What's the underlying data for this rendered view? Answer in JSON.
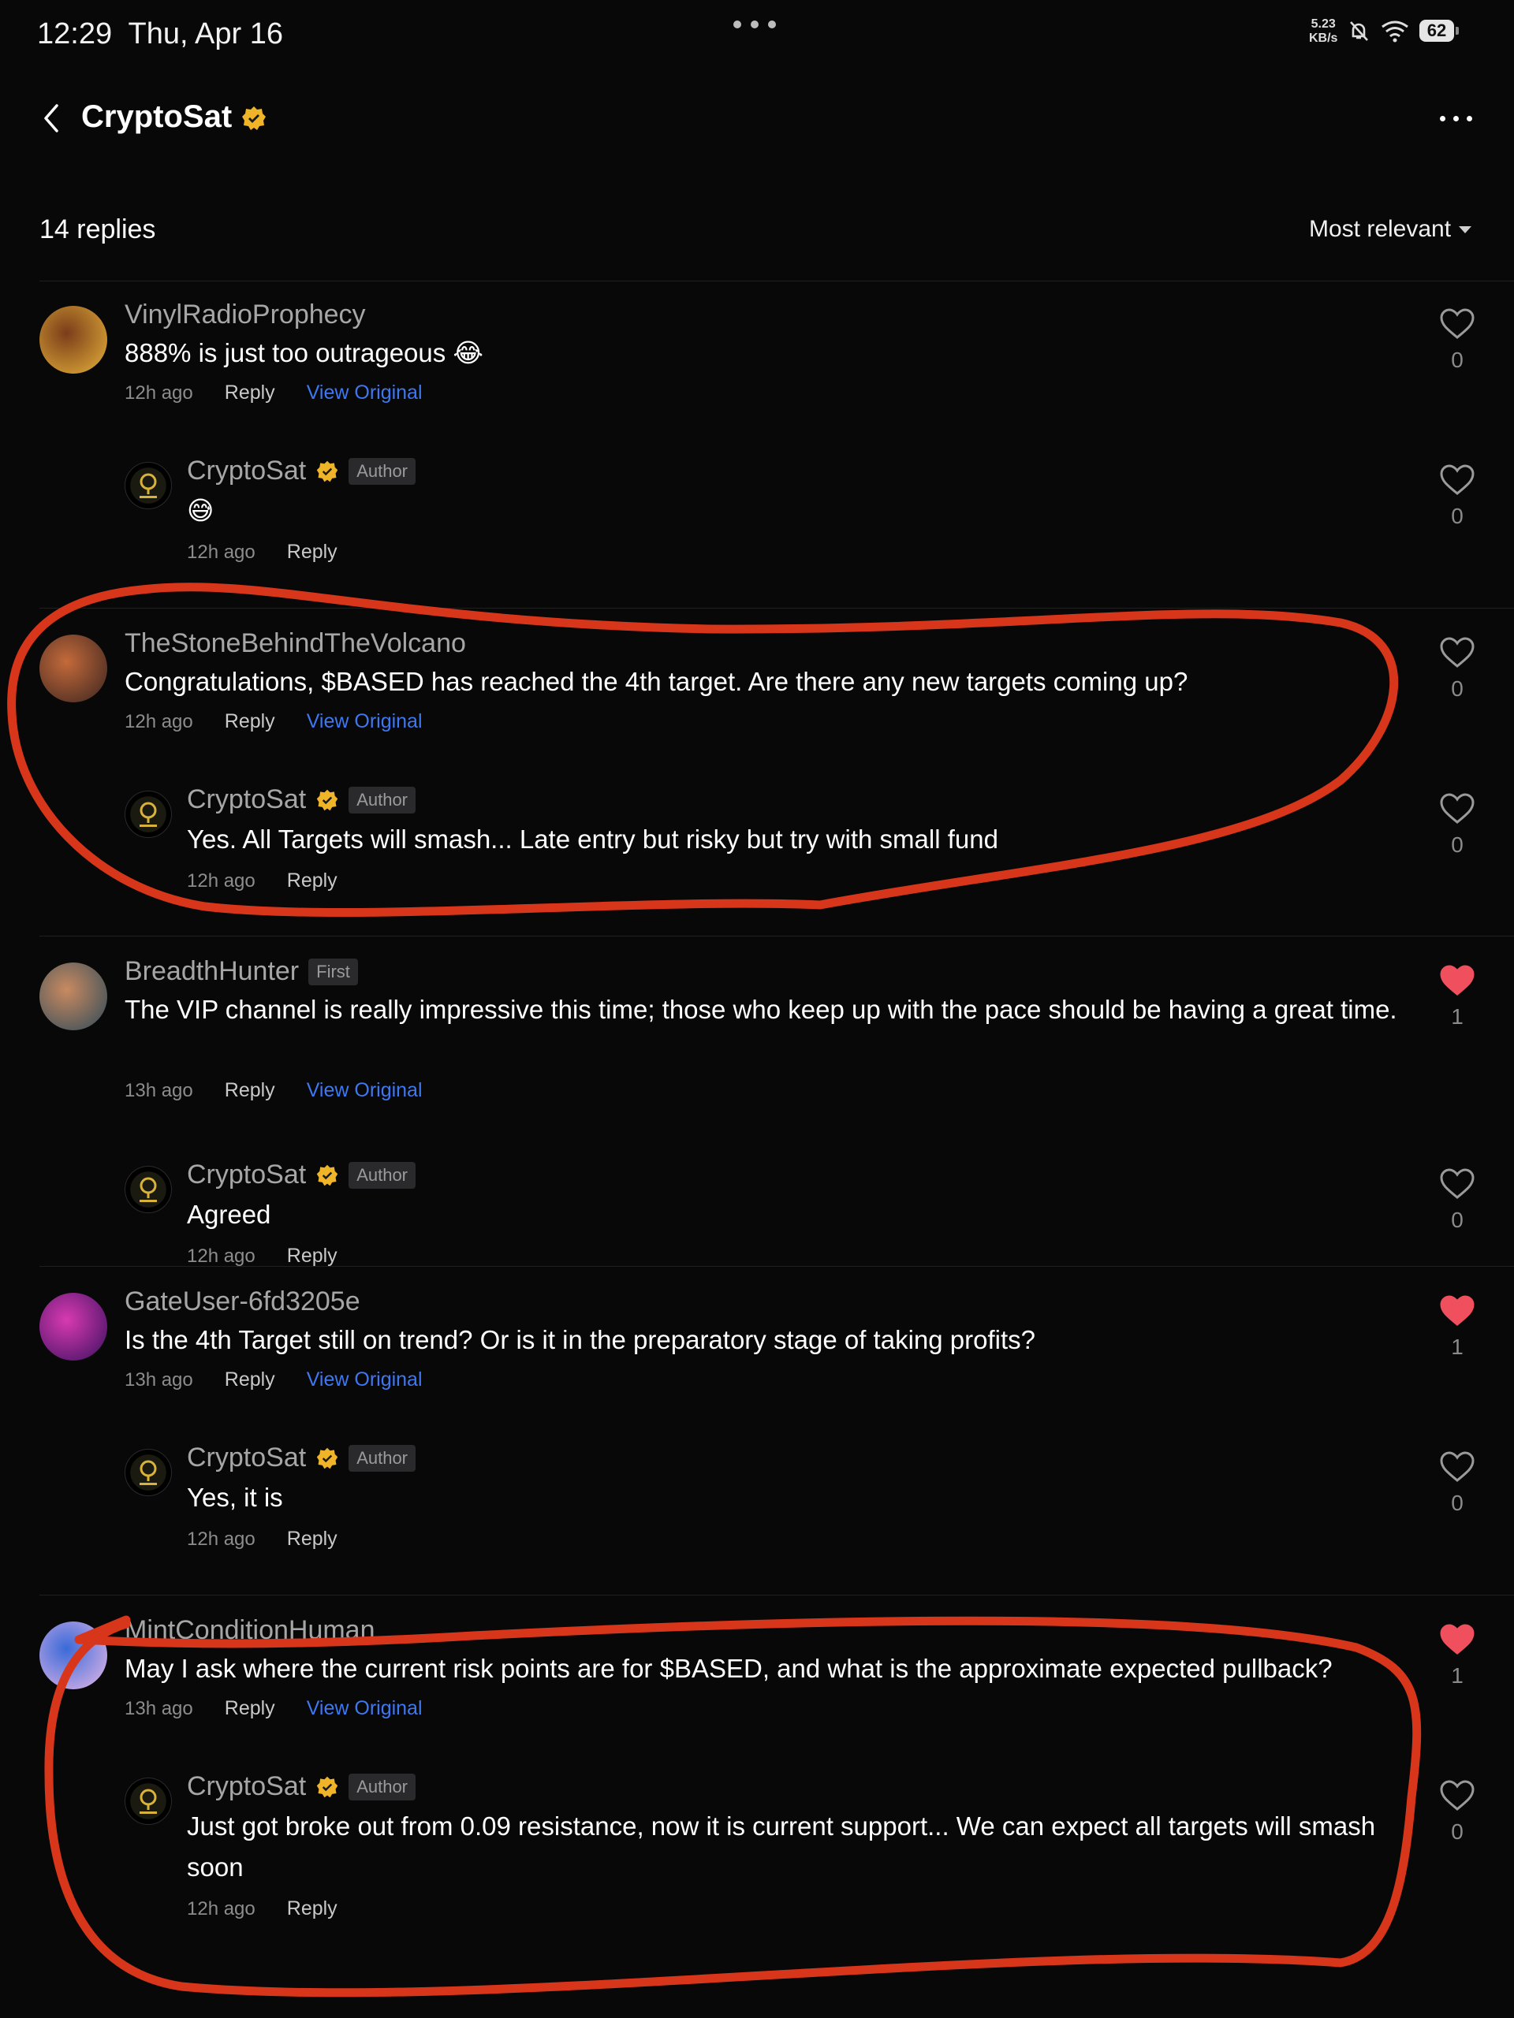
{
  "status_bar": {
    "time": "12:29",
    "date": "Thu, Apr 16",
    "speed_value": "5.23",
    "speed_unit": "KB/s",
    "battery": "62"
  },
  "header": {
    "title": "CryptoSat",
    "back_icon": "chevron-left-icon",
    "more_icon": "more-horizontal-icon"
  },
  "replies": {
    "count_label": "14 replies",
    "sort_label": "Most relevant"
  },
  "colors": {
    "background": "#080809",
    "link": "#3e78f0",
    "liked": "#f0505e",
    "verified": "#f0b429",
    "annotation": "#d8361a"
  },
  "comments": [
    {
      "user": "VinylRadioProphecy",
      "text": "888% is just too outrageous 😂",
      "time": "12h ago",
      "reply_label": "Reply",
      "view_label": "View Original",
      "likes": "0",
      "liked": false,
      "reply": {
        "user": "CryptoSat",
        "badge": "Author",
        "text": "😅",
        "time": "12h ago",
        "reply_label": "Reply",
        "likes": "0"
      }
    },
    {
      "user": "TheStoneBehindTheVolcano",
      "text": "Congratulations, $BASED has reached the 4th target. Are there any new targets coming up?",
      "time": "12h ago",
      "reply_label": "Reply",
      "view_label": "View Original",
      "likes": "0",
      "liked": false,
      "reply": {
        "user": "CryptoSat",
        "badge": "Author",
        "text": "Yes. All Targets will smash... Late entry but risky but try with small fund",
        "time": "12h ago",
        "reply_label": "Reply",
        "likes": "0"
      }
    },
    {
      "user": "BreadthHunter",
      "user_badge": "First",
      "text": "The VIP channel is really impressive this time; those who keep up with the pace should be having a great time.",
      "time": "13h ago",
      "reply_label": "Reply",
      "view_label": "View Original",
      "likes": "1",
      "liked": true,
      "reply": {
        "user": "CryptoSat",
        "badge": "Author",
        "text": "Agreed",
        "time": "12h ago",
        "reply_label": "Reply",
        "likes": "0"
      }
    },
    {
      "user": "GateUser-6fd3205e",
      "text": "Is the 4th Target still on trend? Or is it in the preparatory stage of taking profits?",
      "time": "13h ago",
      "reply_label": "Reply",
      "view_label": "View Original",
      "likes": "1",
      "liked": true,
      "reply": {
        "user": "CryptoSat",
        "badge": "Author",
        "text": "Yes, it is",
        "time": "12h ago",
        "reply_label": "Reply",
        "likes": "0"
      }
    },
    {
      "user": "MintConditionHuman",
      "text": "May I ask where the current risk points are for $BASED, and what is the approximate expected pullback?",
      "time": "13h ago",
      "reply_label": "Reply",
      "view_label": "View Original",
      "likes": "1",
      "liked": true,
      "reply": {
        "user": "CryptoSat",
        "badge": "Author",
        "text": "Just got broke out from 0.09 resistance, now it is current support... We can expect all targets will smash soon",
        "time": "12h ago",
        "reply_label": "Reply",
        "likes": "0"
      }
    }
  ]
}
